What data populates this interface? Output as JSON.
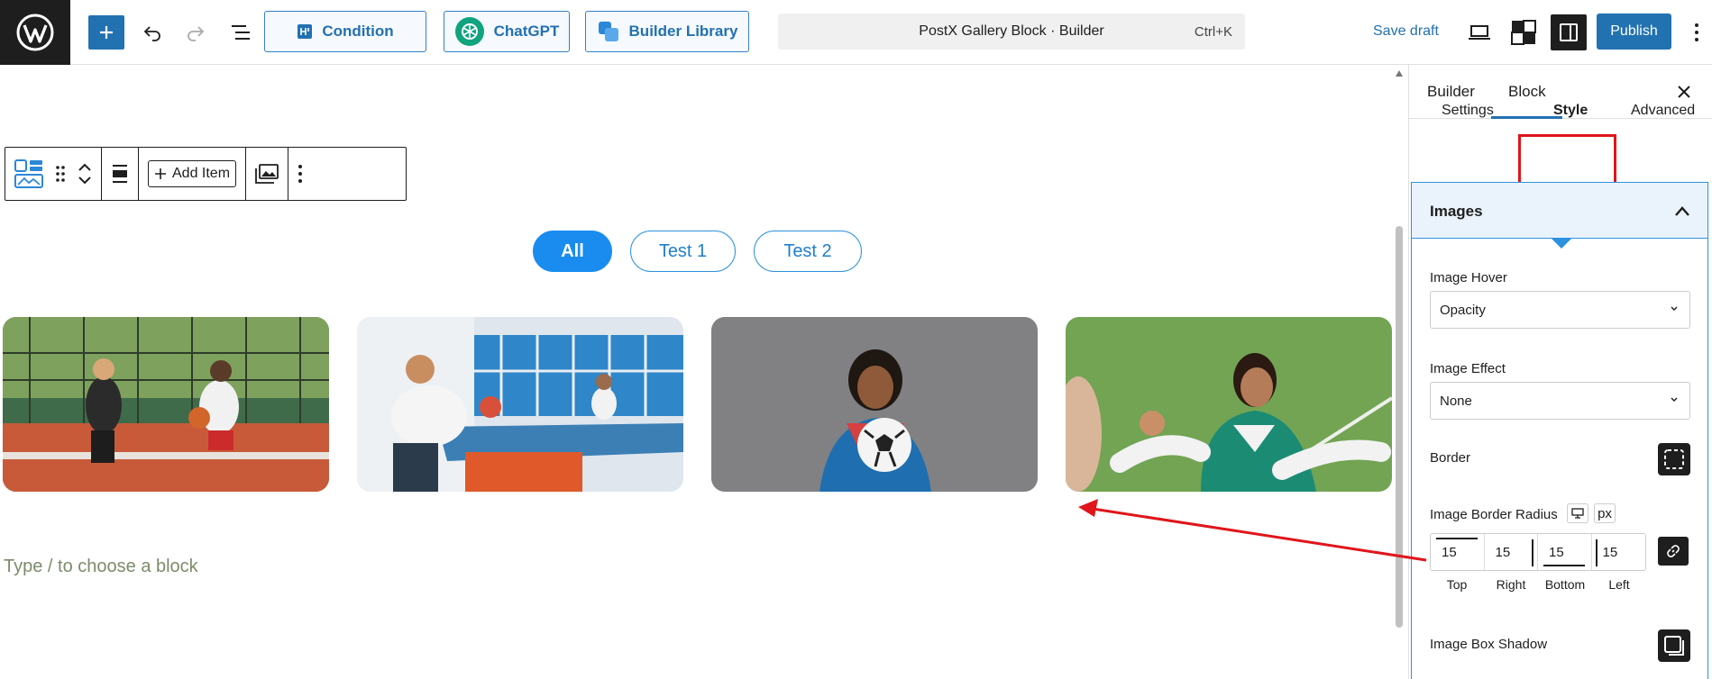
{
  "topbar": {
    "condition_label": "Condition",
    "chatgpt_label": "ChatGPT",
    "library_label": "Builder Library",
    "command_title": "PostX Gallery Block · Builder",
    "command_shortcut": "Ctrl+K",
    "save_draft_label": "Save draft",
    "publish_label": "Publish"
  },
  "block_toolbar": {
    "add_item_label": "Add Item"
  },
  "gallery": {
    "filters": [
      "All",
      "Test 1",
      "Test 2"
    ],
    "active_filter": "All",
    "image_border_radius_px": 15
  },
  "canvas": {
    "placeholder": "Type / to choose a block"
  },
  "sidebar": {
    "tabs": [
      "Builder",
      "Block"
    ],
    "active_tab": "Block",
    "sub_tabs": [
      "Settings",
      "Style",
      "Advanced"
    ],
    "active_sub_tab": "Style",
    "panel_title": "Images",
    "image_hover_label": "Image Hover",
    "image_hover_value": "Opacity",
    "image_effect_label": "Image Effect",
    "image_effect_value": "None",
    "border_label": "Border",
    "border_radius_label": "Image Border Radius",
    "unit": "px",
    "radius": {
      "top": "15",
      "right": "15",
      "bottom": "15",
      "left": "15"
    },
    "radius_labels": {
      "top": "Top",
      "right": "Right",
      "bottom": "Bottom",
      "left": "Left"
    },
    "box_shadow_label": "Image Box Shadow"
  },
  "colors": {
    "accent": "#2271b1",
    "filter_active": "#1a8cf0",
    "highlight": "#e0151b"
  }
}
